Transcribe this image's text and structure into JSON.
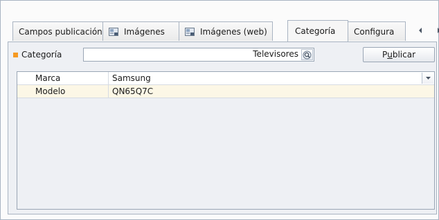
{
  "tabs": [
    {
      "label": "Campos publicación",
      "icon": null,
      "active": false
    },
    {
      "label": "Imágenes",
      "icon": "image-icon",
      "active": false
    },
    {
      "label": "Imágenes (web)",
      "icon": "image-icon",
      "active": false
    },
    {
      "label": "Categoría",
      "icon": null,
      "active": true
    },
    {
      "label": "Configura",
      "icon": null,
      "active": false
    }
  ],
  "category": {
    "label": "Categoría",
    "value": "Televisores"
  },
  "publish_button": {
    "prefix": "P",
    "mnemonic": "u",
    "suffix": "blicar"
  },
  "properties": [
    {
      "key": "Marca",
      "value": "Samsung",
      "has_dropdown": true
    },
    {
      "key": "Modelo",
      "value": "QN65Q7C",
      "has_dropdown": false
    }
  ],
  "colors": {
    "accent_square": "#f59a23",
    "selected_row": "#fcf7e6",
    "border": "#a9b4c2"
  }
}
